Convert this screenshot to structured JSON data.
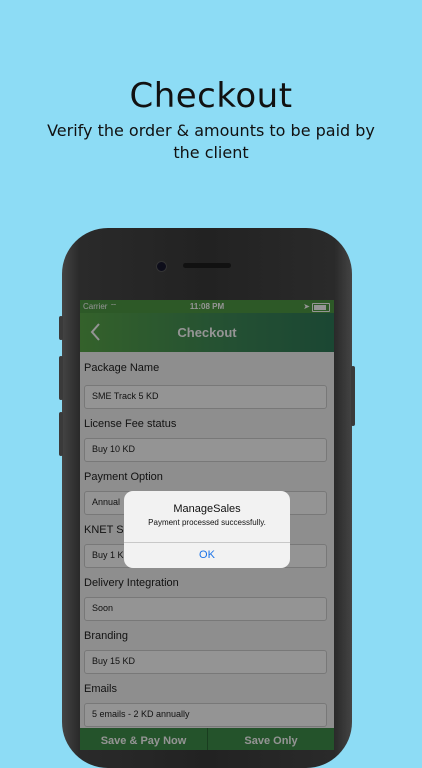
{
  "promo": {
    "headline": "Checkout",
    "subline": "Verify the order & amounts to be paid by the client"
  },
  "status_bar": {
    "carrier": "Carrier",
    "time": "11:08 PM"
  },
  "nav": {
    "back_icon": "chevron-left-icon",
    "title": "Checkout"
  },
  "form": {
    "fields": [
      {
        "label": "Package Name",
        "value": "SME Track 5 KD"
      },
      {
        "label": "License Fee status",
        "value": "Buy 10 KD"
      },
      {
        "label": "Payment Option",
        "value": "Annual"
      },
      {
        "label": "KNET Se",
        "value": "Buy 1 K"
      },
      {
        "label": "Delivery Integration",
        "value": "Soon"
      },
      {
        "label": "Branding",
        "value": "Buy 15 KD"
      },
      {
        "label": "Emails",
        "value": "5 emails - 2 KD annually"
      }
    ]
  },
  "footer": {
    "save_pay": "Save & Pay Now",
    "save_only": "Save Only"
  },
  "alert": {
    "title": "ManageSales",
    "message": "Payment processed successfully.",
    "ok": "OK"
  },
  "colors": {
    "background": "#8ddcf5",
    "nav_green": "#3e8a58",
    "alert_button": "#1a73e8"
  }
}
